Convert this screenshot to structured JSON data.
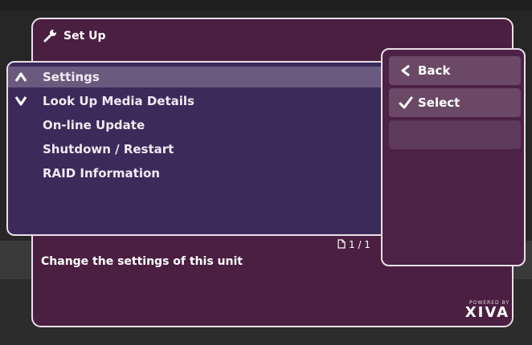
{
  "header": {
    "title": "Set Up"
  },
  "menu": {
    "items": [
      {
        "label": "Settings"
      },
      {
        "label": "Look Up Media Details"
      },
      {
        "label": "On-line Update"
      },
      {
        "label": "Shutdown / Restart"
      },
      {
        "label": "RAID Information"
      }
    ],
    "selected_index": 0
  },
  "side": {
    "back_label": "Back",
    "select_label": "Select"
  },
  "pager": {
    "text": "1 / 1"
  },
  "description": "Change the settings of this unit",
  "logo": {
    "powered": "POWERED BY",
    "brand": "XIVA"
  },
  "icons": {
    "title": "wrench-icon",
    "up": "up-arrow-icon",
    "down": "down-arrow-icon",
    "back": "back-chevron-icon",
    "select": "checkmark-icon",
    "page": "page-icon"
  },
  "colors": {
    "panel_bg": "#4b1f41",
    "menu_bg": "#3b2a5a",
    "highlight": "#6a5a7e",
    "border": "#e9dfe8",
    "button_bg": "#6b4966"
  }
}
